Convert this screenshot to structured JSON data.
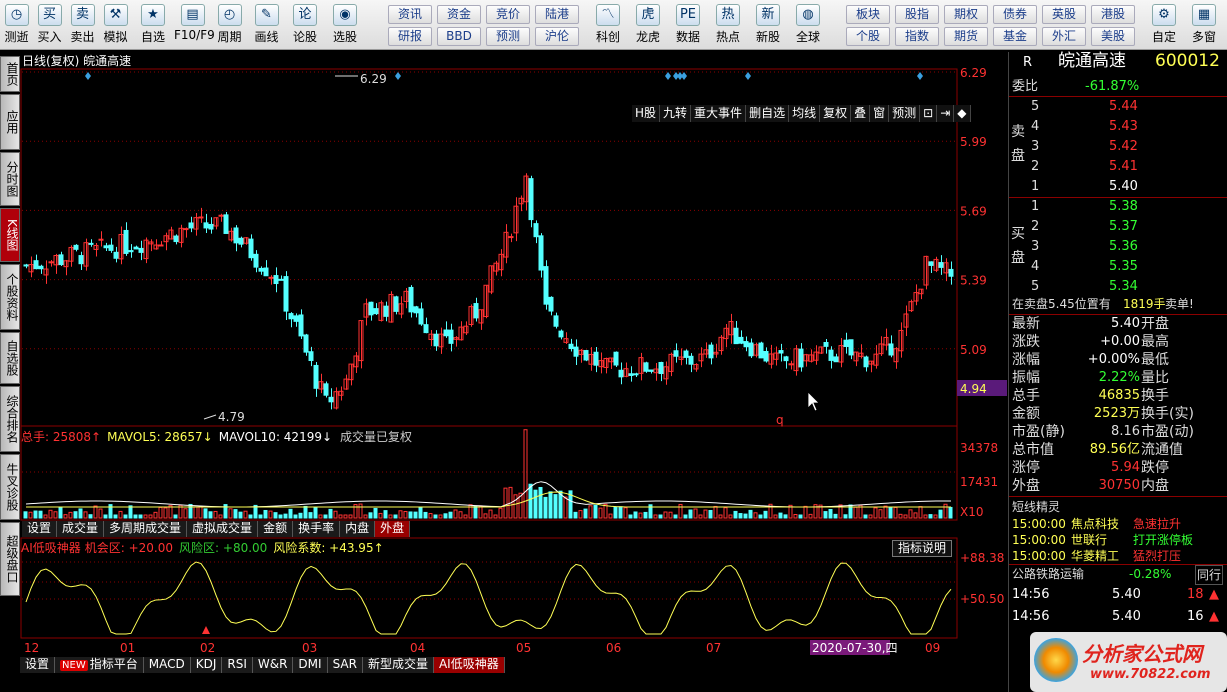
{
  "toolbar": {
    "items": [
      {
        "label": "测逝",
        "icon": "clock-icon"
      },
      {
        "label": "买入",
        "icon": "buy-icon"
      },
      {
        "label": "卖出",
        "icon": "sell-icon"
      },
      {
        "label": "模拟",
        "icon": "hammer-icon"
      },
      {
        "label": "自选",
        "icon": "star-icon"
      },
      {
        "label": "F10/F9",
        "icon": "f10-icon"
      },
      {
        "label": "周期",
        "icon": "period-icon"
      },
      {
        "label": "画线",
        "icon": "pen-icon"
      },
      {
        "label": "论股",
        "icon": "discuss-icon"
      },
      {
        "label": "选股",
        "icon": "select-icon"
      }
    ],
    "grid_buttons": [
      [
        "资讯",
        "资金",
        "竞价",
        "陆港"
      ],
      [
        "研报",
        "BBD",
        "预测",
        "沪伦"
      ]
    ],
    "items2": [
      {
        "label": "科创",
        "icon": "chart-icon"
      },
      {
        "label": "龙虎",
        "icon": "tiger-icon"
      },
      {
        "label": "数据",
        "icon": "pe-icon"
      },
      {
        "label": "热点",
        "icon": "hot-icon"
      },
      {
        "label": "新股",
        "icon": "new-icon"
      },
      {
        "label": "全球",
        "icon": "globe-icon"
      }
    ],
    "grid_buttons2": [
      [
        "板块",
        "股指",
        "期权",
        "债券",
        "英股",
        "港股"
      ],
      [
        "个股",
        "指数",
        "期货",
        "基金",
        "外汇",
        "美股"
      ]
    ],
    "items3": [
      {
        "label": "自定",
        "icon": "custom-icon"
      },
      {
        "label": "多窗",
        "icon": "window-icon"
      }
    ]
  },
  "side_tabs": [
    {
      "label": "首页"
    },
    {
      "label": "应用"
    },
    {
      "label": "分时图"
    },
    {
      "label": "K线图",
      "active": true
    },
    {
      "label": "个股资料"
    },
    {
      "label": "自选股"
    },
    {
      "label": "综合排名"
    },
    {
      "label": "牛叉诊股"
    },
    {
      "label": "超级盘口"
    }
  ],
  "chart": {
    "title": "日线(复权) 皖通高速",
    "pills": [
      "H股",
      "九转",
      "重大事件",
      "删自选",
      "均线",
      "复权",
      "叠",
      "窗",
      "预测",
      "⊡",
      "⇥",
      "◆"
    ],
    "price_ticks": [
      "6.29",
      "5.99",
      "5.69",
      "5.39",
      "5.09"
    ],
    "current_price": "4.94",
    "high_label": "6.29",
    "low_label": "4.79",
    "vol_legend": {
      "total": "总手: 25808↑",
      "ma5": "MAVOL5: 28657↓",
      "ma10": "MAVOL10: 42199↓",
      "note": "成交量已复权"
    },
    "vol_ticks": [
      "34378",
      "17431",
      "X10"
    ],
    "vol_tabs": [
      "设置",
      "成交量",
      "多周期成交量",
      "虚拟成交量",
      "金额",
      "换手率",
      "内盘",
      "外盘"
    ],
    "ind_legend": {
      "name": "AI低吸神器",
      "a": "机会区: +20.00",
      "b": "风险区: +80.00",
      "c": "风险系数: +43.95↑"
    },
    "ind_button": "指标说明",
    "ind_ticks": [
      "+88.38",
      "+50.50"
    ],
    "x_labels": [
      "12",
      "01",
      "02",
      "03",
      "04",
      "05",
      "06",
      "07",
      "09"
    ],
    "date_box": "2020-07-30,四",
    "bottom_tabs": [
      "设置",
      "指标平台",
      "MACD",
      "KDJ",
      "RSI",
      "W&R",
      "DMI",
      "SAR",
      "新型成交量",
      "AI低吸神器"
    ],
    "new_badge": "NEW"
  },
  "chart_data": {
    "type": "line",
    "title": "日线(复权) 皖通高速",
    "x": [
      "12",
      "01",
      "02",
      "03",
      "04",
      "05",
      "06",
      "07",
      "09"
    ],
    "series": [
      {
        "name": "close",
        "values": [
          5.48,
          5.62,
          4.82,
          5.7,
          4.98,
          5.02,
          5.03,
          5.44,
          5.4
        ]
      }
    ],
    "ylim": [
      4.79,
      6.29
    ]
  },
  "quote": {
    "code_letter": "R",
    "name": "皖通高速",
    "code": "600012",
    "weibi_label": "委比",
    "weibi": "-61.87%",
    "sell_label": "卖盘",
    "buy_label": "买盘",
    "sells": [
      {
        "n": "5",
        "p": "5.44"
      },
      {
        "n": "4",
        "p": "5.43"
      },
      {
        "n": "3",
        "p": "5.42"
      },
      {
        "n": "2",
        "p": "5.41"
      },
      {
        "n": "1",
        "p": "5.40"
      }
    ],
    "buys": [
      {
        "n": "1",
        "p": "5.38"
      },
      {
        "n": "2",
        "p": "5.37"
      },
      {
        "n": "3",
        "p": "5.36"
      },
      {
        "n": "4",
        "p": "5.35"
      },
      {
        "n": "5",
        "p": "5.34"
      }
    ],
    "notice": "在卖盘5.45位置有",
    "notice_amt": "1819手",
    "notice_end": "卖单!",
    "stats": [
      {
        "l": "最新",
        "v": "5.40",
        "r": "开盘"
      },
      {
        "l": "涨跌",
        "v": "+0.00",
        "r": "最高"
      },
      {
        "l": "涨幅",
        "v": "+0.00%",
        "r": "最低"
      },
      {
        "l": "振幅",
        "v": "2.22%",
        "r": "量比"
      },
      {
        "l": "总手",
        "v": "46835",
        "r": "换手"
      },
      {
        "l": "金额",
        "v": "2523万",
        "r": "换手(实)"
      },
      {
        "l": "市盈(静)",
        "v": "8.16",
        "r": "市盈(动)"
      },
      {
        "l": "总市值",
        "v": "89.56亿",
        "r": "流通值"
      },
      {
        "l": "涨停",
        "v": "5.94",
        "r": "跌停"
      },
      {
        "l": "外盘",
        "v": "30750",
        "r": "内盘"
      }
    ],
    "sprite_title": "短线精灵",
    "sprites": [
      {
        "t": "15:00:00",
        "n": "焦点科技",
        "e": "急速拉升"
      },
      {
        "t": "15:00:00",
        "n": "世联行",
        "e": "打开涨停板"
      },
      {
        "t": "15:00:00",
        "n": "华菱精工",
        "e": "猛烈打压"
      }
    ],
    "sector": "公路铁路运输",
    "sector_pct": "-0.28%",
    "sector_tab": "同行",
    "ticks": [
      {
        "t": "14:56",
        "p": "5.40",
        "v": "18"
      },
      {
        "t": "14:56",
        "p": "5.40",
        "v": "16"
      }
    ]
  },
  "watermark": {
    "text": "分析家公式网",
    "url": "www.70822.com"
  },
  "colors": {
    "up": "#ff3232",
    "down": "#54ffff",
    "grid": "#8b0000",
    "yellow": "#ffff54"
  }
}
